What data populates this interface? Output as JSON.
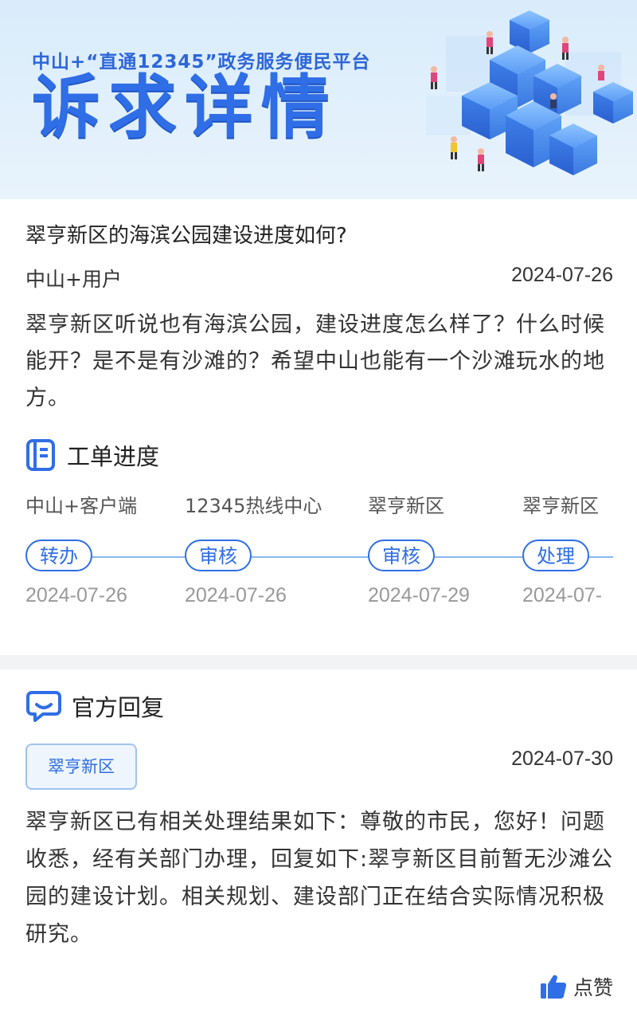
{
  "banner": {
    "subtitle": "中山+“直通12345”政务服务便民平台",
    "title": "诉求详情"
  },
  "question": {
    "title": "翠亨新区的海滨公园建设进度如何?",
    "user": "中山+用户",
    "date": "2024-07-26",
    "content": "翠亨新区听说也有海滨公园，建设进度怎么样了？什么时候能开？是不是有沙滩的？希望中山也能有一个沙滩玩水的地方。"
  },
  "progress": {
    "title": "工单进度",
    "icon": "document-icon",
    "steps": [
      {
        "org": "中山+客户端",
        "action": "转办",
        "date": "2024-07-26"
      },
      {
        "org": "12345热线中心",
        "action": "审核",
        "date": "2024-07-26"
      },
      {
        "org": "翠亨新区",
        "action": "审核",
        "date": "2024-07-29"
      },
      {
        "org": "翠亨新区",
        "action": "处理",
        "date": "2024-07-"
      }
    ]
  },
  "reply": {
    "title": "官方回复",
    "icon": "chat-bubble-icon",
    "department": "翠亨新区",
    "date": "2024-07-30",
    "content": "翠亨新区已有相关处理结果如下：尊敬的市民，您好！问题收悉，经有关部门办理，回复如下:翠亨新区目前暂无沙滩公园的建设计划。相关规划、建设部门正在结合实际情况积极研究。"
  },
  "like": {
    "label": "点赞",
    "icon": "thumbs-up-icon"
  },
  "colors": {
    "accent": "#2f6ee6",
    "banner_bg": "#d9ecfb",
    "muted": "#999999"
  }
}
